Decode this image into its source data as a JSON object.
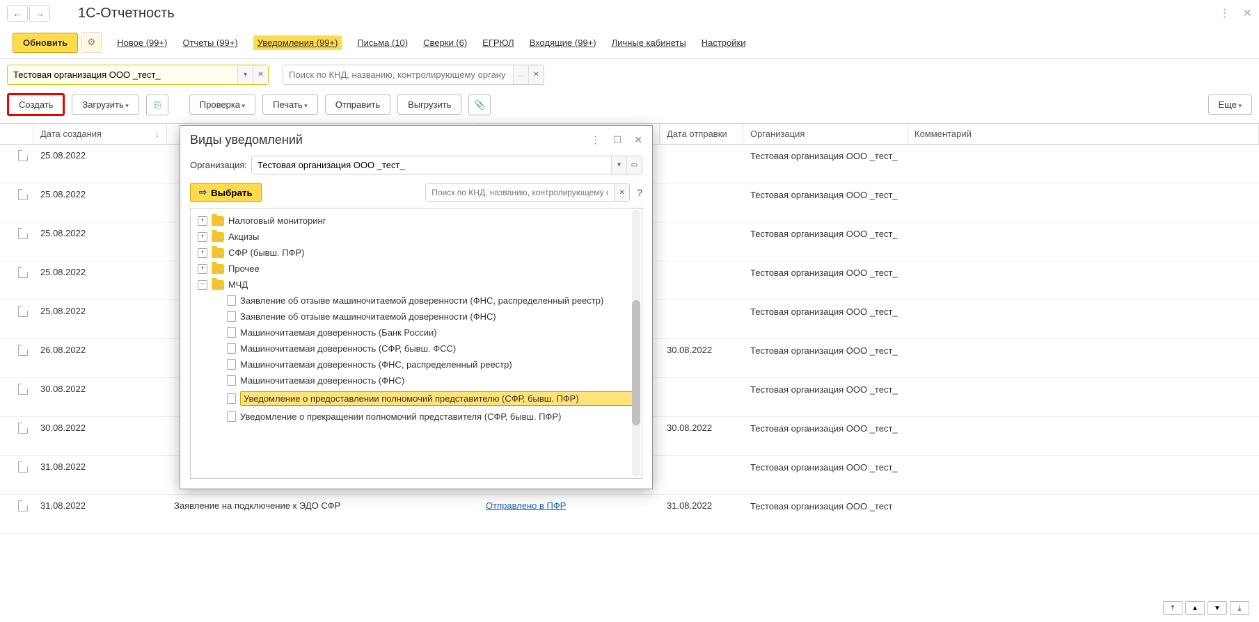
{
  "window": {
    "title": "1С-Отчетность"
  },
  "toolbar1": {
    "update": "Обновить",
    "tabs": {
      "new": "Новое (99+)",
      "reports": "Отчеты (99+)",
      "notifications": "Уведомления (99+)",
      "letters": "Письма (10)",
      "reconcil": "Сверки (6)",
      "egrul": "ЕГРЮЛ",
      "incoming": "Входящие (99+)",
      "cabinets": "Личные кабинеты",
      "settings": "Настройки"
    }
  },
  "filter": {
    "org_value": "Тестовая организация ООО _тест_",
    "search_placeholder": "Поиск по КНД, названию, контролирующему органу"
  },
  "toolbar2": {
    "create": "Создать",
    "load": "Загрузить",
    "check": "Проверка",
    "print": "Печать",
    "send": "Отправить",
    "export": "Выгрузить",
    "more": "Еще"
  },
  "table": {
    "headers": {
      "date": "Дата создания",
      "sent": "Дата отправки",
      "org": "Организация",
      "comment": "Комментарий"
    },
    "rows": [
      {
        "date": "25.08.2022",
        "name": "",
        "status": "",
        "sent": "",
        "org": "Тестовая организация ООО _тест_"
      },
      {
        "date": "25.08.2022",
        "name": "",
        "status": "",
        "sent": "",
        "org": "Тестовая организация ООО _тест_"
      },
      {
        "date": "25.08.2022",
        "name": "",
        "status": "",
        "sent": "",
        "org": "Тестовая организация ООО _тест_"
      },
      {
        "date": "25.08.2022",
        "name": "",
        "status": "",
        "sent": "",
        "org": "Тестовая организация ООО _тест_"
      },
      {
        "date": "25.08.2022",
        "name": "",
        "status": "",
        "sent": "",
        "org": "Тестовая организация ООО _тест_"
      },
      {
        "date": "26.08.2022",
        "name": "",
        "status": "",
        "sent": "30.08.2022",
        "org": "Тестовая организация ООО _тест_"
      },
      {
        "date": "30.08.2022",
        "name": "",
        "status": "",
        "sent": "",
        "org": "Тестовая организация ООО _тест_"
      },
      {
        "date": "30.08.2022",
        "name": "",
        "status": "",
        "sent": "30.08.2022",
        "org": "Тестовая организация ООО _тест_"
      },
      {
        "date": "31.08.2022",
        "name": "",
        "status": "",
        "sent": "",
        "org": "Тестовая организация ООО _тест_"
      },
      {
        "date": "31.08.2022",
        "name": "Заявление на подключение к ЭДО СФР",
        "status": "Отправлено в ПФР",
        "sent": "31.08.2022",
        "org": "Тестовая организация ООО _тест"
      }
    ]
  },
  "modal": {
    "title": "Виды уведомлений",
    "org_label": "Организация:",
    "org_value": "Тестовая организация ООО _тест_",
    "select": "Выбрать",
    "search_placeholder": "Поиск по КНД, названию, контролирующему о...",
    "help": "?",
    "tree": {
      "folders": [
        {
          "label": "Налоговый мониторинг",
          "expanded": false
        },
        {
          "label": "Акцизы",
          "expanded": false
        },
        {
          "label": "СФР (бывш. ПФР)",
          "expanded": false
        },
        {
          "label": "Прочее",
          "expanded": false
        },
        {
          "label": "МЧД",
          "expanded": true
        }
      ],
      "items": [
        "Заявление об отзыве машиночитаемой доверенности (ФНС, распределенный реестр)",
        "Заявление об отзыве машиночитаемой доверенности (ФНС)",
        "Машиночитаемая доверенность (Банк России)",
        "Машиночитаемая доверенность (СФР, бывш. ФСС)",
        "Машиночитаемая доверенность (ФНС, распределенный реестр)",
        "Машиночитаемая доверенность (ФНС)",
        "Уведомление о предоставлении полномочий представителю (СФР, бывш. ПФР)",
        "Уведомление о прекращении полномочий представителя (СФР, бывш. ПФР)"
      ],
      "highlighted_index": 6
    }
  }
}
